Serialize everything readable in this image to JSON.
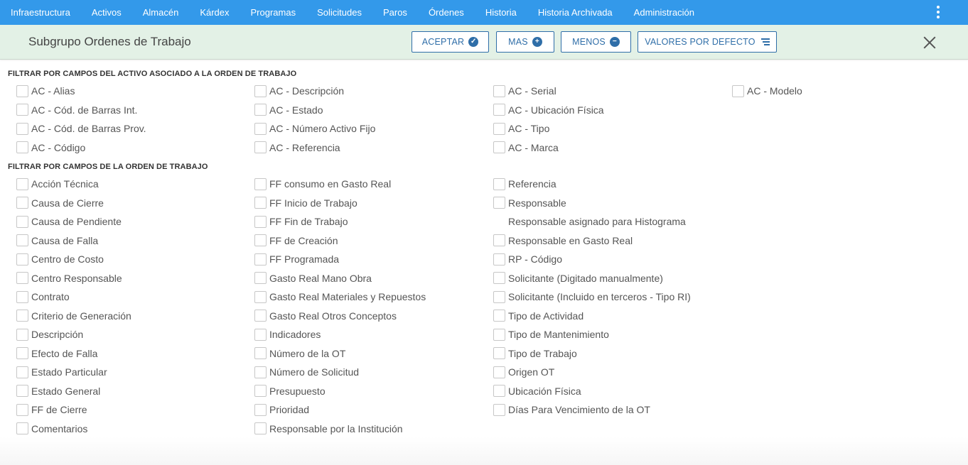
{
  "nav": {
    "items": [
      "Infraestructura",
      "Activos",
      "Almacén",
      "Kárdex",
      "Programas",
      "Solicitudes",
      "Paros",
      "Órdenes",
      "Historia",
      "Historia Archivada",
      "Administración"
    ],
    "menu_icon": "more-vert-icon",
    "bar_color": "#3399ea"
  },
  "header": {
    "title": "Subgrupo Ordenes de Trabajo",
    "accept_label": "ACEPTAR",
    "more_label": "MAS",
    "less_label": "MENOS",
    "defaults_label": "VALORES POR DEFECTO",
    "close_icon": "close-icon",
    "background": "#e3f1e6",
    "accent": "#2f6ea8"
  },
  "asset_section": {
    "title": "FILTRAR POR CAMPOS DEL ACTIVO ASOCIADO A LA ORDEN DE TRABAJO",
    "columns": [
      [
        "AC - Alias",
        "AC - Cód. de Barras Int.",
        "AC - Cód. de Barras Prov.",
        "AC - Código"
      ],
      [
        "AC - Descripción",
        "AC - Estado",
        "AC - Número Activo Fijo",
        "AC - Referencia"
      ],
      [
        "AC - Serial",
        "AC - Ubicación Física",
        "AC - Tipo",
        "AC - Marca"
      ],
      [
        "AC - Modelo"
      ]
    ]
  },
  "order_section": {
    "title": "FILTRAR POR CAMPOS DE LA ORDEN DE TRABAJO",
    "columns": [
      [
        "Acción Técnica",
        "Causa de Cierre",
        "Causa de Pendiente",
        "Causa de Falla",
        "Centro de Costo",
        "Centro Responsable",
        "Contrato",
        "Criterio de Generación",
        "Descripción",
        "Efecto de Falla",
        "Estado Particular",
        "Estado General",
        "FF de Cierre",
        "Comentarios"
      ],
      [
        "FF consumo en Gasto Real",
        "FF Inicio de Trabajo",
        "FF Fin de Trabajo",
        "FF de Creación",
        "FF Programada",
        "Gasto Real Mano Obra",
        "Gasto Real Materiales y Repuestos",
        "Gasto Real Otros Conceptos",
        "Indicadores",
        "Número de la OT",
        "Número de Solicitud",
        "Presupuesto",
        "Prioridad",
        "Responsable por la Institución"
      ],
      [
        "Referencia",
        "Responsable",
        "Responsable asignado para Histograma",
        "Responsable en Gasto Real",
        "RP - Código",
        "Solicitante (Digitado manualmente)",
        "Solicitante (Incluido en terceros - Tipo RI)",
        "Tipo de Actividad",
        "Tipo de Mantenimiento",
        "Tipo de Trabajo",
        "Origen OT",
        "Ubicación Física",
        "Días Para Vencimiento de la OT"
      ]
    ]
  }
}
